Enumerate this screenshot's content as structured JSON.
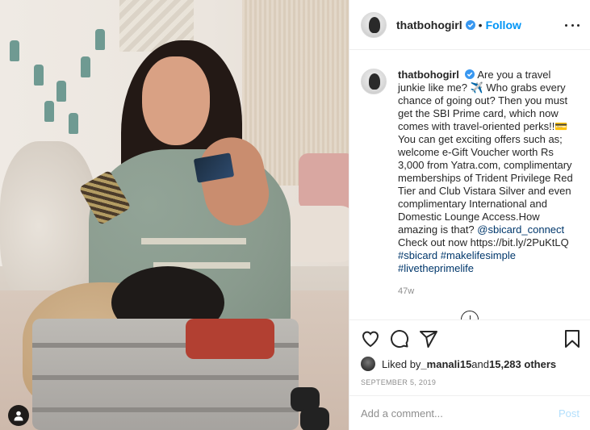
{
  "post": {
    "username": "thatbohogirl",
    "follow_separator": "•",
    "follow_label": "Follow",
    "more_icon": "ellipsis-icon",
    "verified_icon": "verified-badge-icon",
    "accent_color": "#0095f6"
  },
  "caption": {
    "username": "thatbohogirl",
    "text_part1": " Are you a travel junkie like me? ✈️ Who grabs every chance of going out? Then you must get the SBI Prime card, which now comes with travel-oriented perks!!💳 You can get exciting offers such as; welcome e-Gift Voucher worth Rs 3,000 from Yatra.com, complimentary memberships of Trident Privilege Red Tier and Club Vistara Silver and even complimentary International and Domestic Lounge Access.How amazing is that? ",
    "mention": "@sbicard_connect",
    "text_part2": " Check out now https://bit.ly/2PuKtLQ ",
    "hashtag1": "#sbicard",
    "hashtag2": "#makelifesimple",
    "hashtag3": "#livetheprimelife",
    "age": "47w"
  },
  "actions": {
    "like_icon": "heart-icon",
    "comment_icon": "comment-icon",
    "share_icon": "share-icon",
    "save_icon": "bookmark-icon"
  },
  "likes": {
    "prefix": "Liked by ",
    "user": "_manali15",
    "middle": " and ",
    "count": "15,283 others"
  },
  "date": "SEPTEMBER 5, 2019",
  "comment": {
    "placeholder": "Add a comment...",
    "post_label": "Post"
  }
}
